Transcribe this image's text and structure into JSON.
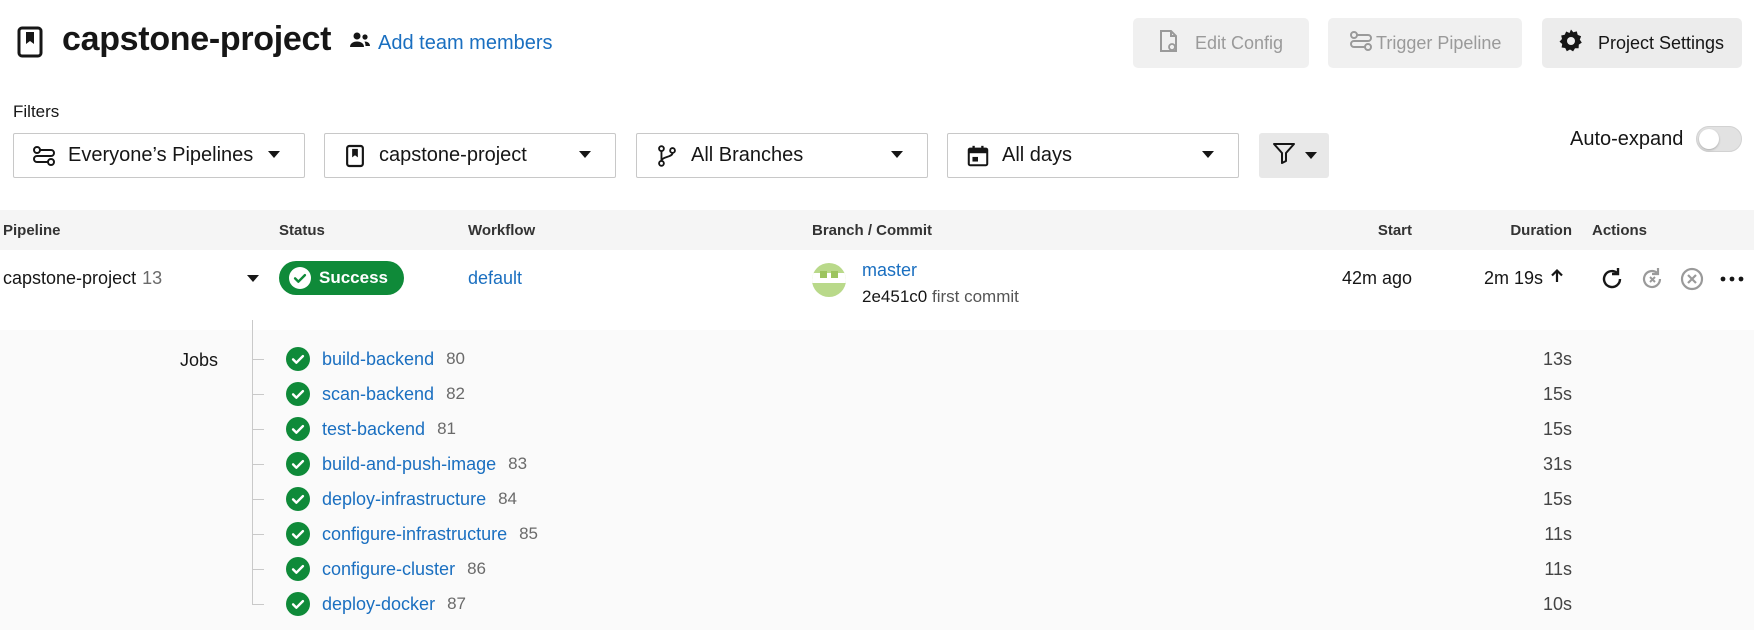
{
  "header": {
    "project_title": "capstone-project",
    "add_team": "Add team members",
    "edit_config": "Edit Config",
    "trigger_pipeline": "Trigger Pipeline",
    "project_settings": "Project Settings"
  },
  "filters": {
    "label": "Filters",
    "pipelines": "Everyone’s Pipelines",
    "project": "capstone-project",
    "branches": "All Branches",
    "days": "All days",
    "auto_expand": "Auto-expand",
    "auto_expand_on": false
  },
  "table": {
    "headers": {
      "pipeline": "Pipeline",
      "status": "Status",
      "workflow": "Workflow",
      "branch_commit": "Branch / Commit",
      "start": "Start",
      "duration": "Duration",
      "actions": "Actions"
    },
    "row": {
      "pipeline": "capstone-project",
      "number": "13",
      "status": "Success",
      "workflow": "default",
      "branch": "master",
      "commit_hash": "2e451c0",
      "commit_message": "first commit",
      "start": "42m ago",
      "duration": "2m 19s"
    }
  },
  "jobs": {
    "label": "Jobs",
    "items": [
      {
        "name": "build-backend",
        "number": "80",
        "duration": "13s"
      },
      {
        "name": "scan-backend",
        "number": "82",
        "duration": "15s"
      },
      {
        "name": "test-backend",
        "number": "81",
        "duration": "15s"
      },
      {
        "name": "build-and-push-image",
        "number": "83",
        "duration": "31s"
      },
      {
        "name": "deploy-infrastructure",
        "number": "84",
        "duration": "15s"
      },
      {
        "name": "configure-infrastructure",
        "number": "85",
        "duration": "11s"
      },
      {
        "name": "configure-cluster",
        "number": "86",
        "duration": "11s"
      },
      {
        "name": "deploy-docker",
        "number": "87",
        "duration": "10s"
      }
    ]
  },
  "colors": {
    "success": "#0f8a39",
    "link": "#1a6fc0"
  }
}
